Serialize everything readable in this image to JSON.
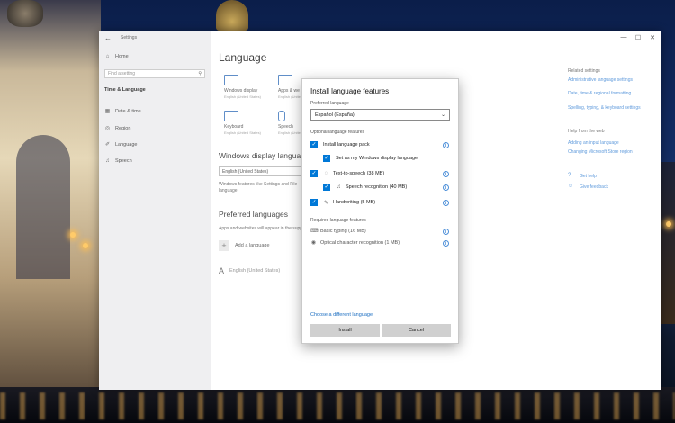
{
  "window": {
    "title": "Settings",
    "back_glyph": "←",
    "controls": [
      "—",
      "☐",
      "✕"
    ]
  },
  "sidebar": {
    "home": "Home",
    "search_placeholder": "Find a setting",
    "section": "Time & Language",
    "items": [
      {
        "label": "Date & time",
        "icon": "calendar-icon",
        "glyph": "▦"
      },
      {
        "label": "Region",
        "icon": "globe-icon",
        "glyph": "◎"
      },
      {
        "label": "Language",
        "icon": "language-icon",
        "glyph": "✐"
      },
      {
        "label": "Speech",
        "icon": "microphone-icon",
        "glyph": "♫"
      }
    ]
  },
  "main": {
    "title": "Language",
    "tiles": [
      {
        "label": "Windows display",
        "sub": "English (United States)"
      },
      {
        "label": "Apps & we",
        "sub": "English (United States)"
      },
      {
        "label": "Keyboard",
        "sub": "English (United States)"
      },
      {
        "label": "Speech",
        "sub": "English (United States)"
      }
    ],
    "display_lang_heading": "Windows display language",
    "display_lang_value": "English (United States)",
    "display_lang_desc": "Windows features like Settings and File language",
    "preferred_heading": "Preferred languages",
    "preferred_desc": "Apps and websites will appear in the support",
    "add_language": "Add a language",
    "installed_language": "English (United States)"
  },
  "related": {
    "heading": "Related settings",
    "links": [
      "Administrative language settings",
      "Date, time & regional formatting",
      "Spelling, typing, & keyboard settings"
    ],
    "help_heading": "Help from the web",
    "help_links": [
      "Adding an input language",
      "Changing Microsoft Store region"
    ],
    "get_help": "Get help",
    "give_feedback": "Give feedback"
  },
  "dialog": {
    "title": "Install language features",
    "preferred_label": "Preferred language",
    "preferred_value": "Español (España)",
    "optional_label": "Optional language features",
    "features": [
      {
        "label": "Install language pack",
        "checked": true
      },
      {
        "label": "Set as my Windows display language",
        "checked": true
      },
      {
        "label": "Text-to-speech (38 MB)",
        "checked": true
      },
      {
        "label": "Speech recognition (40 MB)",
        "checked": true
      },
      {
        "label": "Handwriting (5 MB)",
        "checked": true
      }
    ],
    "required_label": "Required language features",
    "required": [
      "Basic typing (16 MB)",
      "Optical character recognition (1 MB)"
    ],
    "choose_link": "Choose a different language",
    "install_button": "Install",
    "cancel_button": "Cancel"
  },
  "colors": {
    "accent": "#0078d7",
    "link": "#4b8ed8"
  }
}
